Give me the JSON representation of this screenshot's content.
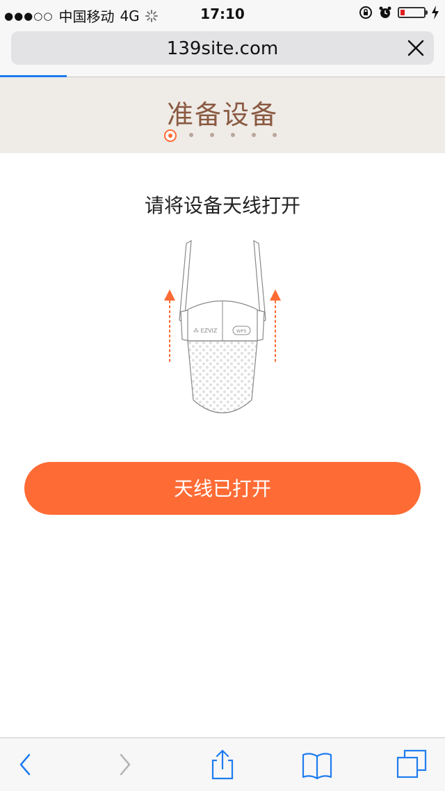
{
  "status_bar": {
    "carrier": "中国移动",
    "network": "4G",
    "time": "17:10",
    "battery_level": 0.2
  },
  "browser": {
    "url": "139site.com",
    "load_progress": 0.15
  },
  "step": {
    "title": "准备设备",
    "current": 1,
    "total": 6
  },
  "content": {
    "instruction": "请将设备天线打开",
    "device_brand": "EZVIZ",
    "device_button_label": "WPS",
    "confirm_button": "天线已打开"
  },
  "colors": {
    "accent": "#ff6b35",
    "header_bg": "#efebe6",
    "title_color": "#8a5a42",
    "ios_blue": "#1e7cf0"
  },
  "icons": {
    "toolbar": [
      "back-chevron-icon",
      "forward-chevron-icon",
      "share-icon",
      "bookmarks-icon",
      "tabs-icon"
    ]
  }
}
